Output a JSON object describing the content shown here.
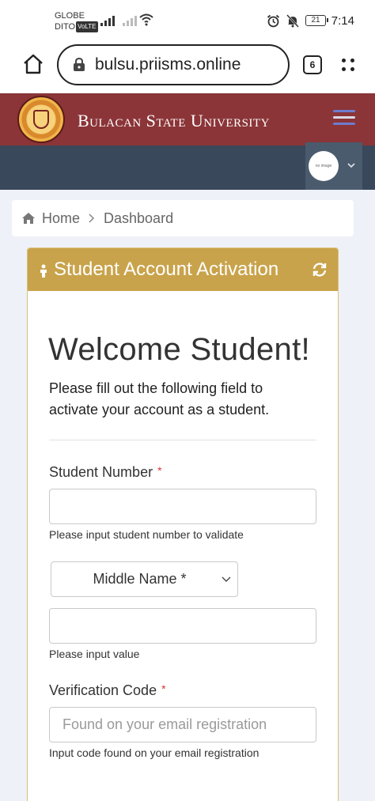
{
  "status_bar": {
    "carrier_line1": "GLOBE",
    "carrier_line2": "DITO",
    "volte_badge": "VoLTE",
    "battery_level": "21",
    "time": "7:14",
    "icons": [
      "signal-icon",
      "signal-icon",
      "wifi-icon",
      "alarm-icon",
      "mute-icon",
      "battery-icon"
    ]
  },
  "browser": {
    "url": "bulsu.priisms.online",
    "tab_count": "6"
  },
  "header": {
    "university_name": "Bulacan State University",
    "colors": {
      "brand": "#8b3538",
      "subbar": "#39485a",
      "accent": "#c9a34b"
    }
  },
  "user": {
    "avatar_text": "no image"
  },
  "breadcrumb": {
    "home": "Home",
    "current": "Dashboard"
  },
  "card": {
    "title": "Student Account Activation",
    "welcome": "Welcome Student!",
    "intro": "Please fill out the following field to activate your account as a student.",
    "student_number": {
      "label": "Student Number",
      "value": "",
      "help": "Please input student number to validate"
    },
    "name_select": {
      "selected": "Middle Name *"
    },
    "name_field": {
      "value": "",
      "help": "Please input value"
    },
    "verification": {
      "label": "Verification Code",
      "placeholder": "Found on your email registration",
      "help": "Input code found on your email registration"
    },
    "required_mark": "*"
  }
}
